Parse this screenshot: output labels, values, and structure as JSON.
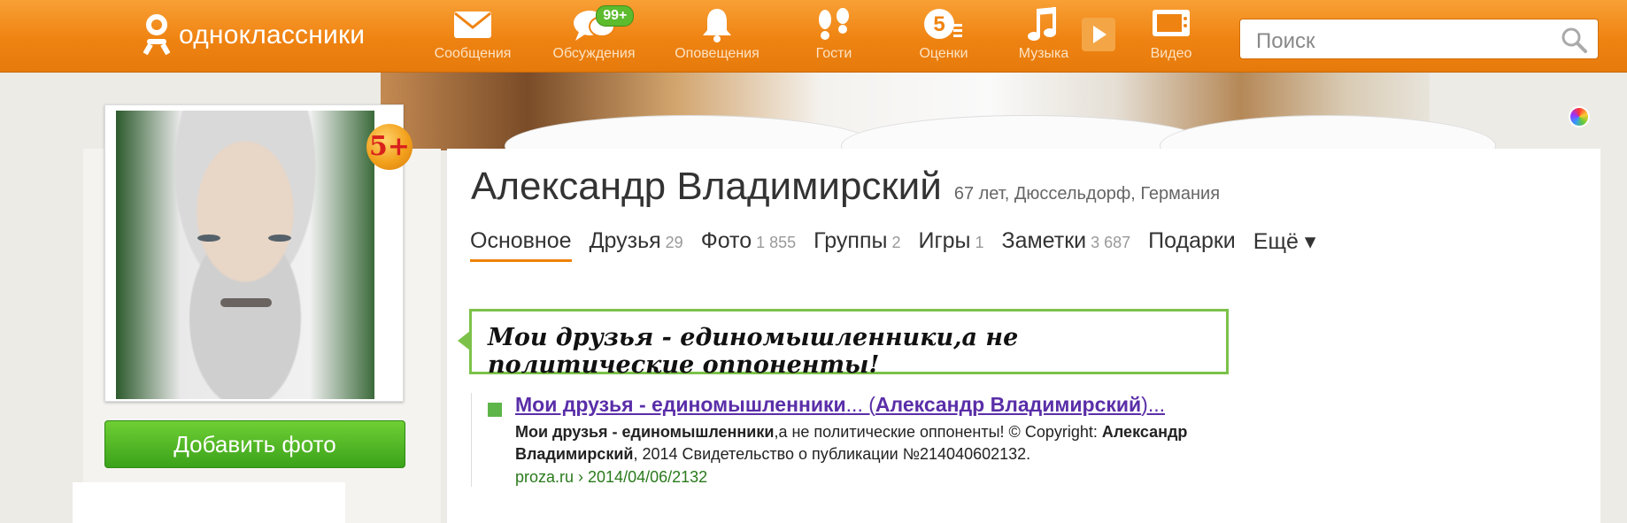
{
  "app": {
    "logo_text": "одноклассники"
  },
  "nav": [
    {
      "id": "messages",
      "label": "Сообщения",
      "icon": "envelope-icon"
    },
    {
      "id": "discussions",
      "label": "Обсуждения",
      "icon": "chat-bubbles-icon",
      "badge": "99+"
    },
    {
      "id": "notifications",
      "label": "Оповещения",
      "icon": "bell-icon"
    },
    {
      "id": "guests",
      "label": "Гости",
      "icon": "footprints-icon"
    },
    {
      "id": "ratings",
      "label": "Оценки",
      "icon": "rating-5-icon"
    },
    {
      "id": "music",
      "label": "Музыка",
      "icon": "music-note-icon"
    },
    {
      "id": "video",
      "label": "Видео",
      "icon": "tv-icon"
    }
  ],
  "search": {
    "placeholder": "Поиск"
  },
  "profile": {
    "name": "Александр Владимирский",
    "meta": "67 лет, Дюссельдорф, Германия",
    "rating_badge": "5+",
    "add_photo_label": "Добавить фото"
  },
  "tabs": [
    {
      "label": "Основное",
      "count": "",
      "active": true
    },
    {
      "label": "Друзья",
      "count": "29"
    },
    {
      "label": "Фото",
      "count": "1 855"
    },
    {
      "label": "Группы",
      "count": "2"
    },
    {
      "label": "Игры",
      "count": "1"
    },
    {
      "label": "Заметки",
      "count": "3 687"
    },
    {
      "label": "Подарки",
      "count": ""
    },
    {
      "label": "Ещё ▾",
      "count": ""
    }
  ],
  "status": {
    "text": "Мои друзья - единомышленники,а не политические оппоненты!"
  },
  "result": {
    "title_bold1": "Мои друзья - единомышленники",
    "title_plain1": "... (",
    "title_bold2": "Александр Владимирский",
    "title_plain2": ")...",
    "snippet_bold1": "Мои друзья - единомышленники",
    "snippet_plain1": ",а не политические оппоненты! © Copyright: ",
    "snippet_bold2": "Александр Владимирский",
    "snippet_plain2": ", 2014 Свидетельство о публикации №214040602132.",
    "url": "proza.ru › 2014/04/06/2132"
  },
  "colors": {
    "topbar": "#ef8312",
    "status_border": "#7cc24a",
    "button_green": "#4cb224",
    "link_purple": "#5a2ea8",
    "url_green": "#2a7a1c"
  }
}
